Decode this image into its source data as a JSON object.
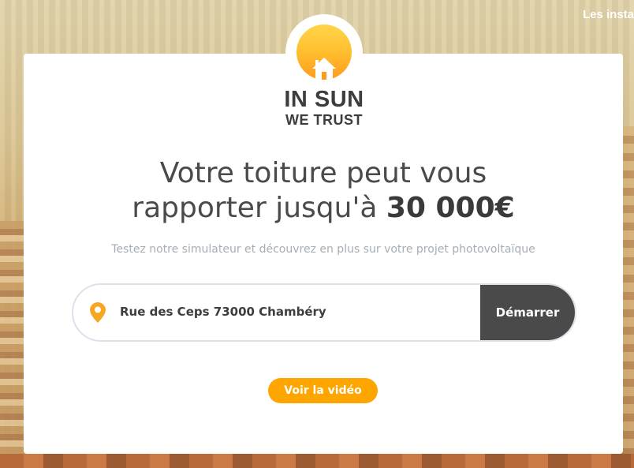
{
  "nav": {
    "top_link": "Les insta"
  },
  "logo": {
    "line1": "IN SUN",
    "line2": "WE TRUST",
    "icon": "sun-house-logo"
  },
  "hero": {
    "headline_part1": "Votre toiture peut vous",
    "headline_part2": "rapporter jusqu'à",
    "headline_amount": "30 000€",
    "subtitle": "Testez notre simulateur et découvrez en plus sur votre projet photovoltaïque"
  },
  "search": {
    "icon": "map-pin-icon",
    "address_value": "Rue des Ceps 73000 Chambéry",
    "start_label": "Démarrer"
  },
  "video": {
    "label": "Voir la vidéo"
  },
  "colors": {
    "accent": "#ffa500",
    "dark_button": "#4a4a4a",
    "pin": "#f5a623",
    "text": "#4a4a4a",
    "muted": "#a6adb4"
  }
}
